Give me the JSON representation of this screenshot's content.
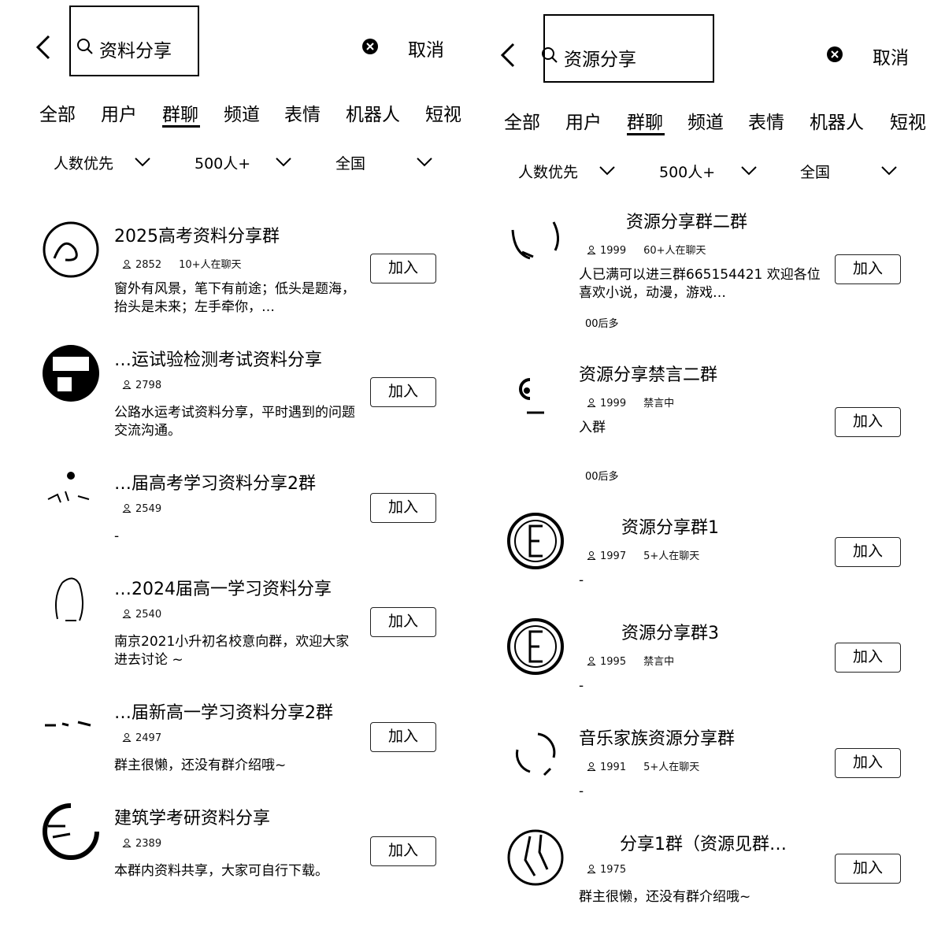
{
  "left": {
    "query": "资料分享",
    "cancel": "取消",
    "tabs": [
      "全部",
      "用户",
      "群聊",
      "频道",
      "表情",
      "机器人",
      "短视"
    ],
    "filters": [
      "人数优先",
      "500人+",
      "全国"
    ],
    "join_label": "加入",
    "items": [
      {
        "title": "2025高考资料分享群",
        "count": "2852",
        "extra": "10+人在聊天",
        "desc": "窗外有风景，笔下有前途；低头是题海，抬头是未来；左手牵你，…",
        "tag": ""
      },
      {
        "title": "…运试验检测考试资料分享",
        "count": "2798",
        "extra": "",
        "desc": "公路水运考试资料分享，平时遇到的问题交流沟通。",
        "tag": ""
      },
      {
        "title": "…届高考学习资料分享2群",
        "count": "2549",
        "extra": "",
        "desc": "-",
        "tag": ""
      },
      {
        "title": "…2024届高一学习资料分享",
        "count": "2540",
        "extra": "",
        "desc": "南京2021小升初名校意向群，欢迎大家进去讨论 ~",
        "tag": ""
      },
      {
        "title": "…届新高一学习资料分享2群",
        "count": "2497",
        "extra": "",
        "desc": "群主很懒，还没有群介绍哦~",
        "tag": ""
      },
      {
        "title": "建筑学考研资料分享",
        "count": "2389",
        "extra": "",
        "desc": "本群内资料共享，大家可自行下载。",
        "tag": ""
      }
    ]
  },
  "right": {
    "query": "资源分享",
    "cancel": "取消",
    "tabs": [
      "全部",
      "用户",
      "群聊",
      "频道",
      "表情",
      "机器人",
      "短视"
    ],
    "filters": [
      "人数优先",
      "500人+",
      "全国"
    ],
    "join_label": "加入",
    "items": [
      {
        "title": "资源分享群二群",
        "count": "1999",
        "extra": "60+人在聊天",
        "desc": "人已满可以进三群665154421 欢迎各位喜欢小说，动漫，游戏…",
        "tag": "00后多"
      },
      {
        "title": "资源分享禁言二群",
        "count": "1999",
        "extra": "禁言中",
        "desc": "入群",
        "tag": "00后多"
      },
      {
        "title": "资源分享群1",
        "count": "1997",
        "extra": "5+人在聊天",
        "desc": "-",
        "tag": ""
      },
      {
        "title": "资源分享群3",
        "count": "1995",
        "extra": "禁言中",
        "desc": "-",
        "tag": ""
      },
      {
        "title": "音乐家族资源分享群",
        "count": "1991",
        "extra": "5+人在聊天",
        "desc": "-",
        "tag": ""
      },
      {
        "title": "分享1群（资源见群…",
        "count": "1975",
        "extra": "",
        "desc": "群主很懒，还没有群介绍哦~",
        "tag": ""
      }
    ]
  },
  "icons": {
    "back": "chevron-left-icon",
    "search": "search-icon",
    "clear": "clear-icon",
    "filter": "chevron-down-icon",
    "member": "person-icon"
  }
}
